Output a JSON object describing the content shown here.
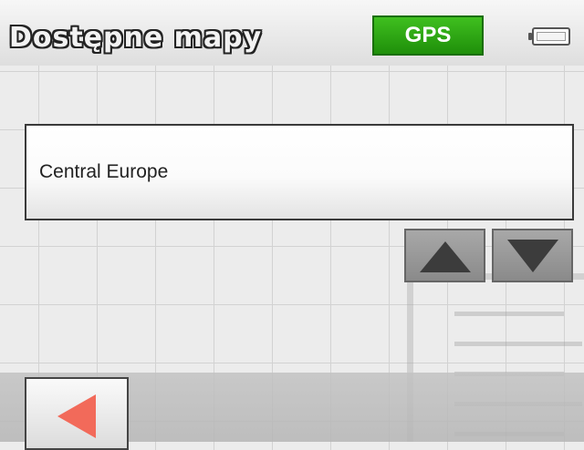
{
  "header": {
    "title": "Dostępne mapy",
    "gps_label": "GPS",
    "battery_icon": "battery-icon"
  },
  "map_list": {
    "items": [
      {
        "label": "Central Europe"
      }
    ]
  },
  "controls": {
    "scroll_up_icon": "triangle-up-icon",
    "scroll_down_icon": "triangle-down-icon",
    "back_icon": "triangle-left-icon"
  },
  "colors": {
    "gps_green": "#2ea612",
    "back_arrow": "#f26a5a",
    "scroll_arrow": "#3c3c3c",
    "grid": "#d2d2d2"
  }
}
